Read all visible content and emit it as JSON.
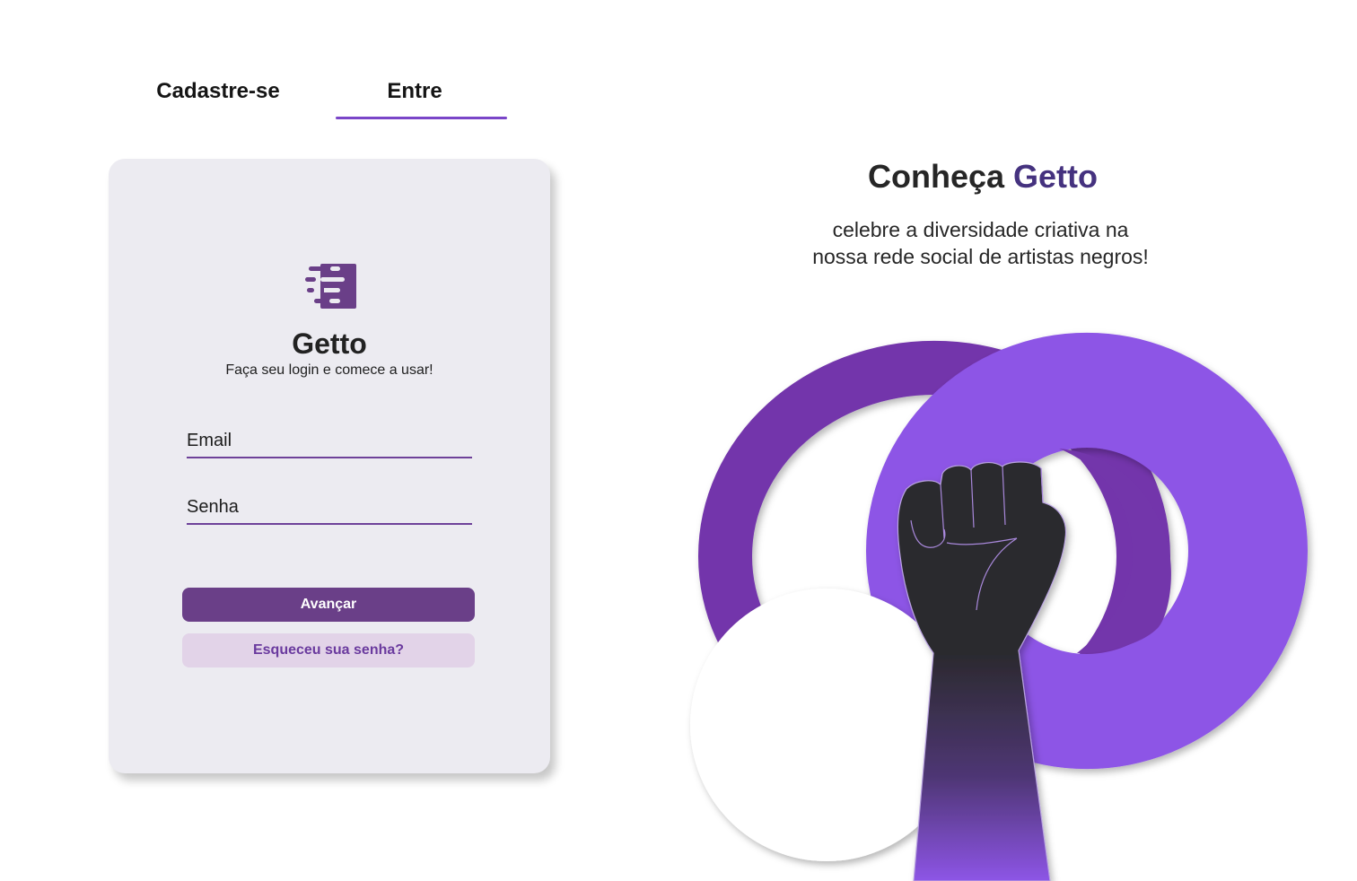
{
  "tabs": {
    "signup_label": "Cadastre-se",
    "login_label": "Entre",
    "active": "Entre"
  },
  "login": {
    "brand": "Getto",
    "tagline": "Faça seu login e comece a usar!",
    "email_label": "Email",
    "password_label": "Senha",
    "submit_label": "Avançar",
    "forgot_label": "Esqueceu sua senha?"
  },
  "promo": {
    "title_prefix": "Conheça",
    "title_accent": "Getto",
    "subtitle_line1": "celebre a diversidade criativa na",
    "subtitle_line2": "nossa rede social de artistas negros!"
  },
  "icons": {
    "logo": "getto-logo-icon",
    "illustration": "raised-fist-illustration"
  },
  "colors": {
    "accent": "#7a45c8",
    "primary_button": "#6a3f88",
    "secondary_button": "#e2d3e8",
    "secondary_text": "#6a3a9e",
    "card_bg": "#ecebf1",
    "ring_dark": "#7336ab",
    "ring_light": "#8d55e6",
    "title_accent": "#45327f"
  }
}
